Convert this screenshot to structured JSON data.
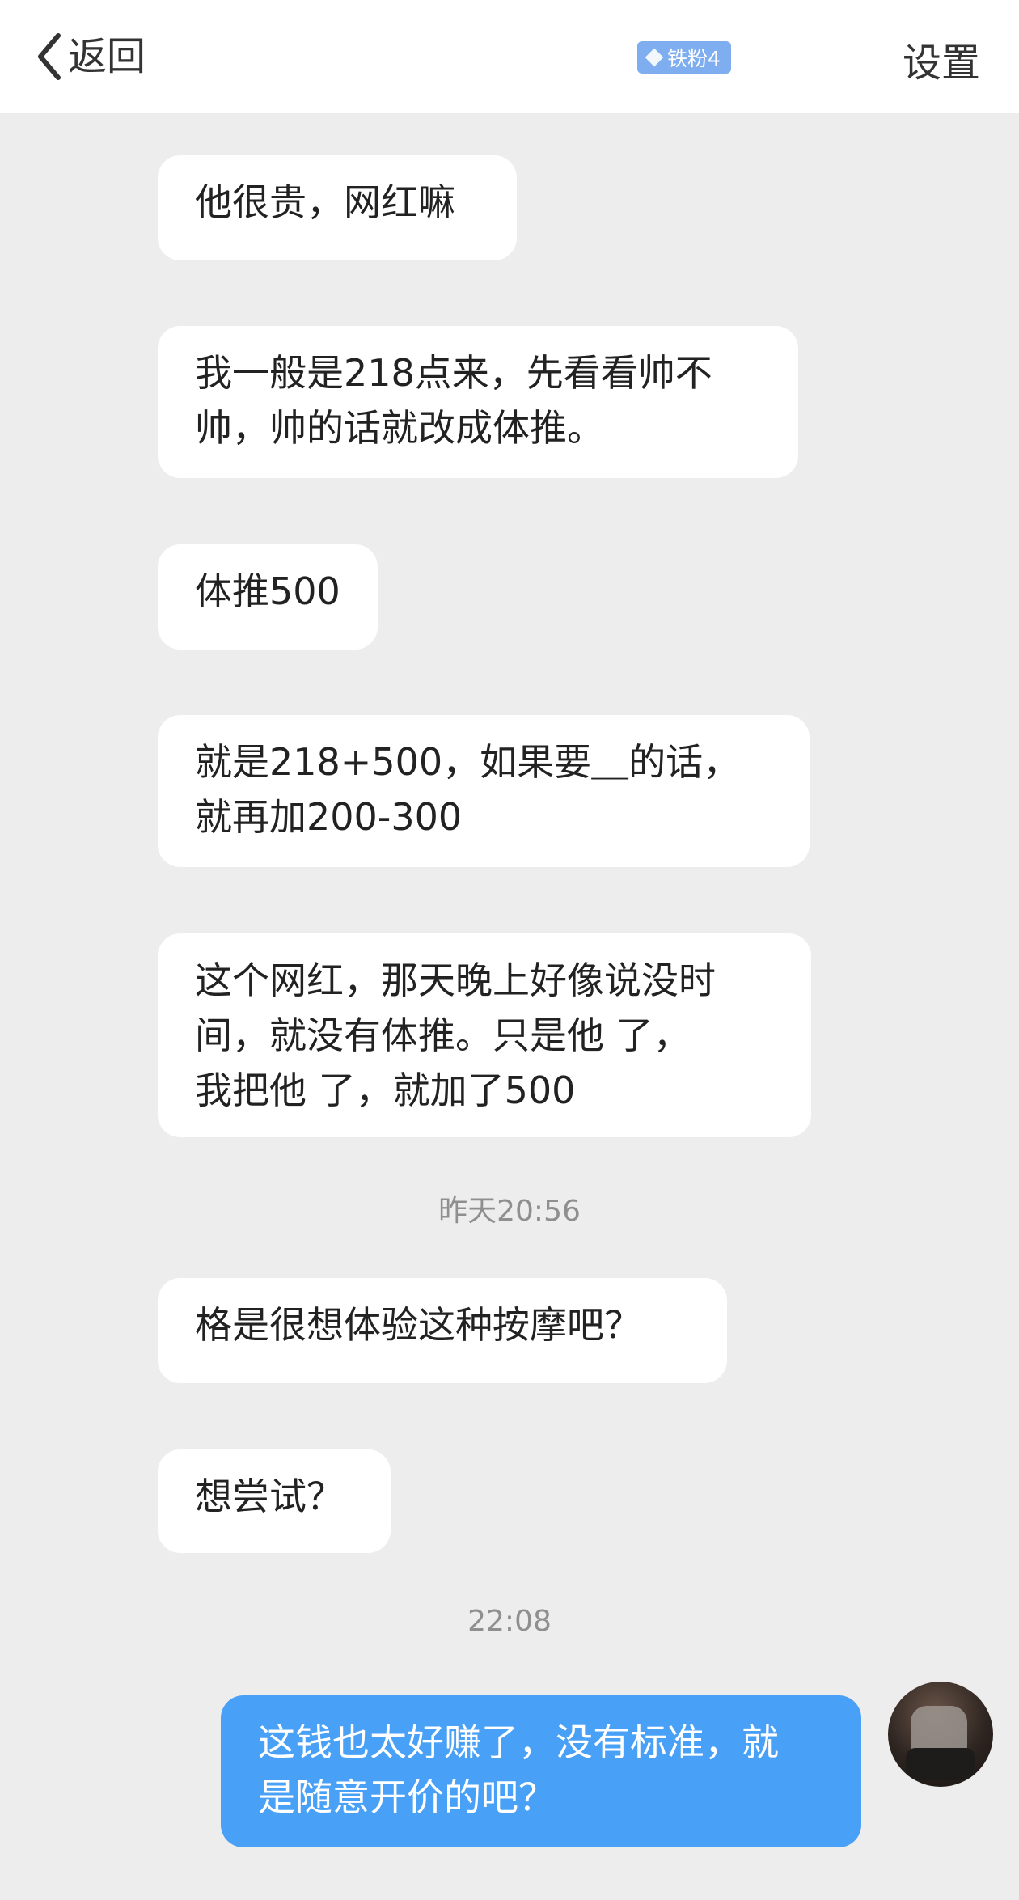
{
  "header": {
    "back_label": "返回",
    "badge_label": "铁粉4",
    "settings_label": "设置"
  },
  "messages": [
    {
      "lines": [
        "他很贵，网红嘛"
      ]
    },
    {
      "lines": [
        "我一般是218点来，先看看帅不",
        "帅，帅的话就改成体推。"
      ]
    },
    {
      "lines": [
        "体推500"
      ]
    },
    {
      "lines": [
        "就是218+500，如果要＿的话，",
        "就再加200-300"
      ]
    },
    {
      "lines": [
        "这个网红，那天晚上好像说没时",
        "间，就没有体推。只是他    了，",
        "我把他        了，就加了500"
      ]
    },
    {
      "lines": [
        "格是很想体验这种按摩吧？"
      ]
    },
    {
      "lines": [
        "想尝试？"
      ]
    },
    {
      "lines": [
        "这钱也太好赚了，没有标准，就",
        "是随意开价的吧？"
      ]
    }
  ],
  "timestamps": [
    "昨天20:56",
    "22:08"
  ],
  "colors": {
    "background": "#ededed",
    "incoming_bubble": "#ffffff",
    "outgoing_bubble": "#48a1f7",
    "badge": "#7eaef0"
  }
}
